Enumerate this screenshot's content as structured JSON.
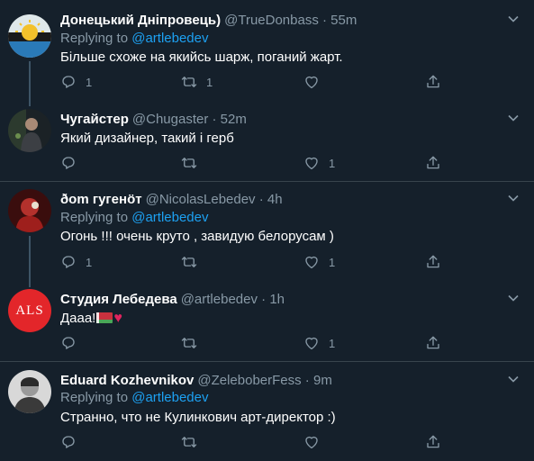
{
  "tweets": [
    {
      "name": "Донецький Дніпровець)",
      "handle": "@TrueDonbass",
      "time": "55m",
      "replying_label": "Replying to ",
      "replying_to": "@artlebedev",
      "text": "Більше схоже на якийсь шарж, поганий жарт.",
      "reply_count": "1",
      "retweet_count": "1",
      "like_count": ""
    },
    {
      "name": "Чугайстер",
      "handle": "@Chugaster",
      "time": "52m",
      "text": "Який дизайнер, такий і герб",
      "reply_count": "",
      "retweet_count": "",
      "like_count": "1"
    },
    {
      "name": "ðom гугенöт",
      "handle": "@NicolasLebedev",
      "time": "4h",
      "replying_label": "Replying to ",
      "replying_to": "@artlebedev",
      "text": "Огонь !!! очень круто , завидую белорусам )",
      "reply_count": "1",
      "retweet_count": "",
      "like_count": "1"
    },
    {
      "name": "Студия Лебедева",
      "handle": "@artlebedev",
      "time": "1h",
      "text": "Дааа!",
      "avatar_text": "ALS",
      "reply_count": "",
      "retweet_count": "",
      "like_count": "1"
    },
    {
      "name": "Eduard Kozhevnikov",
      "handle": "@ZeleboberFess",
      "time": "9m",
      "replying_label": "Replying to ",
      "replying_to": "@artlebedev",
      "text": "Странно, что не Кулинкович арт-директор :)",
      "reply_count": "",
      "retweet_count": "",
      "like_count": ""
    }
  ],
  "separator": " · ",
  "icons": {
    "reply": "reply-icon",
    "retweet": "retweet-icon",
    "like": "heart-icon",
    "share": "share-icon",
    "caret": "chevron-down-icon",
    "flag": "belarus-flag-emoji",
    "heart_emoji": "red-heart-emoji"
  },
  "colors": {
    "background": "#15202b",
    "divider": "#38444d",
    "secondary_text": "#8899a6",
    "link": "#1da1f2",
    "avatar_als": "#e3262a"
  }
}
